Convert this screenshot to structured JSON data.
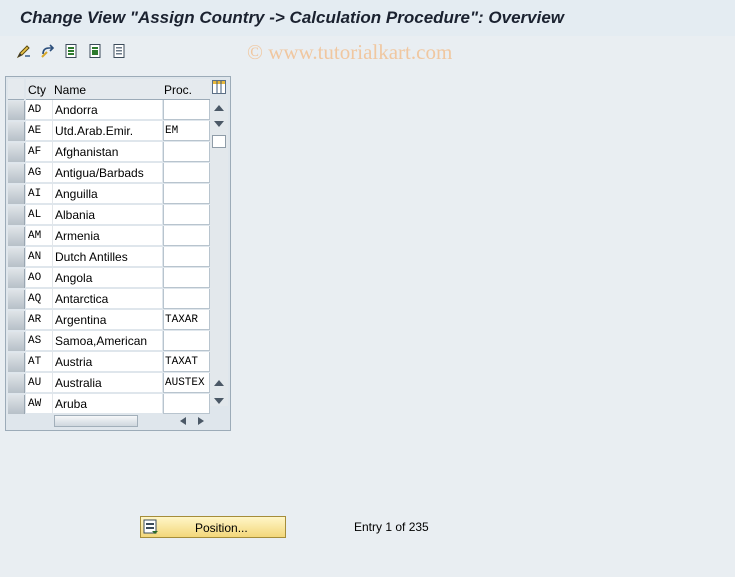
{
  "window": {
    "title": "Change View \"Assign Country -> Calculation Procedure\": Overview"
  },
  "toolbar": {
    "buttons": [
      {
        "icon": "edit-pencil-icon"
      },
      {
        "icon": "undo-icon"
      },
      {
        "icon": "select-all-icon"
      },
      {
        "icon": "select-block-icon"
      },
      {
        "icon": "deselect-all-icon"
      }
    ]
  },
  "watermark": "© www.tutorialkart.com",
  "table": {
    "columns": [
      "Cty",
      "Name",
      "Proc."
    ],
    "rows": [
      {
        "cty": "AD",
        "name": "Andorra",
        "proc": ""
      },
      {
        "cty": "AE",
        "name": "Utd.Arab.Emir.",
        "proc": "EM"
      },
      {
        "cty": "AF",
        "name": "Afghanistan",
        "proc": ""
      },
      {
        "cty": "AG",
        "name": "Antigua/Barbads",
        "proc": ""
      },
      {
        "cty": "AI",
        "name": "Anguilla",
        "proc": ""
      },
      {
        "cty": "AL",
        "name": "Albania",
        "proc": ""
      },
      {
        "cty": "AM",
        "name": "Armenia",
        "proc": ""
      },
      {
        "cty": "AN",
        "name": "Dutch Antilles",
        "proc": ""
      },
      {
        "cty": "AO",
        "name": "Angola",
        "proc": ""
      },
      {
        "cty": "AQ",
        "name": "Antarctica",
        "proc": ""
      },
      {
        "cty": "AR",
        "name": "Argentina",
        "proc": "TAXAR"
      },
      {
        "cty": "AS",
        "name": "Samoa,American",
        "proc": ""
      },
      {
        "cty": "AT",
        "name": "Austria",
        "proc": "TAXAT"
      },
      {
        "cty": "AU",
        "name": "Australia",
        "proc": "AUSTEX"
      },
      {
        "cty": "AW",
        "name": "Aruba",
        "proc": ""
      }
    ]
  },
  "footer": {
    "position_button": "Position...",
    "entry_text": "Entry 1 of 235"
  }
}
